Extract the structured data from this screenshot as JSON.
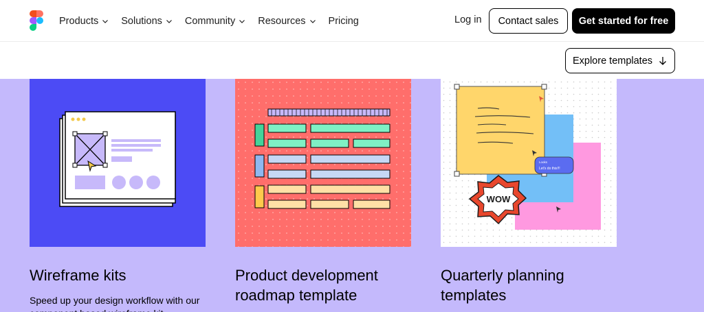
{
  "nav": {
    "links": [
      {
        "label": "Products",
        "has_menu": true
      },
      {
        "label": "Solutions",
        "has_menu": true
      },
      {
        "label": "Community",
        "has_menu": true
      },
      {
        "label": "Resources",
        "has_menu": true
      },
      {
        "label": "Pricing",
        "has_menu": false
      }
    ],
    "login_label": "Log in",
    "contact_label": "Contact sales",
    "start_label": "Get started for free"
  },
  "subbar": {
    "explore_label": "Explore templates"
  },
  "cards": [
    {
      "title": "Wireframe kits",
      "description": "Speed up your design workflow with our component based wireframe kit.",
      "image_bg": "#4c4bf5"
    },
    {
      "title": "Product development roadmap template",
      "image_bg": "#ff6e6b"
    },
    {
      "title": "Quarterly planning templates",
      "sticky_text": "Looks / Let's do this!!!",
      "sticker_text": "WOW",
      "image_bg": "#ffffff"
    }
  ],
  "colors": {
    "section_bg": "#c4b9fc",
    "primary_button": "#000000"
  }
}
